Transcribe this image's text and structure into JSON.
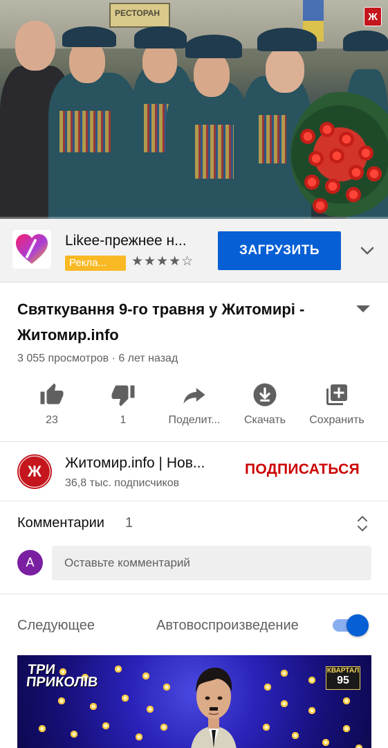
{
  "video": {
    "overlay_sign_text": "РЕСТОРАН",
    "channel_watermark": "Ж",
    "progress_fraction": 0.0
  },
  "ad": {
    "title": "Likee-прежнее н...",
    "badge": "Рекла...",
    "rating_stars": 4.5,
    "stars_text": "★★★★☆",
    "install_label": "ЗАГРУЗИТЬ",
    "icon": "likee-heart-logo",
    "colors": {
      "button": "#065fd4",
      "badge": "#f9b925"
    }
  },
  "video_info": {
    "title": "Святкування 9-го травня у Житомирі - Житомир.info",
    "meta": "3 055 просмотров · 6 лет назад"
  },
  "actions": [
    {
      "label": "23",
      "icon": "thumbs-up-icon"
    },
    {
      "label": "1",
      "icon": "thumbs-down-icon"
    },
    {
      "label": "Поделит...",
      "icon": "share-icon"
    },
    {
      "label": "Скачать",
      "icon": "download-icon"
    },
    {
      "label": "Сохранить",
      "icon": "add-to-playlist-icon"
    }
  ],
  "channel": {
    "name": "Житомир.info | Нов...",
    "subscribers": "36,8 тыс. подписчиков",
    "subscribe_label": "ПОДПИСАТЬСЯ",
    "avatar_letter": "Ж",
    "subscribe_color": "#cc0000"
  },
  "comments": {
    "label": "Комментарии",
    "count": "1",
    "user_initial": "A",
    "placeholder": "Оставьте комментарий"
  },
  "up_next": {
    "label": "Следующее",
    "autoplay_label": "Автовоспроизведение",
    "autoplay_on": true,
    "thumb_logo_left": "ТРИ ПРИКОЛІВ",
    "thumb_logo_right_top": "КВАРТАЛ",
    "thumb_logo_right_bottom": "95"
  }
}
